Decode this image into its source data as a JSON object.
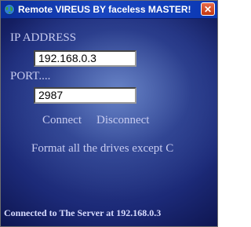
{
  "window": {
    "title": "Remote VIREUS BY faceless MASTER!",
    "close_label": "✕"
  },
  "form": {
    "ip_label": "IP ADDRESS",
    "ip_value": "192.168.0.3",
    "port_label": "PORT....",
    "port_value": "2987"
  },
  "actions": {
    "connect": "Connect",
    "disconnect": "Disconnect",
    "format": "Format all the drives except C"
  },
  "status": {
    "text": "Connected to The Server at 192.168.0.3"
  }
}
